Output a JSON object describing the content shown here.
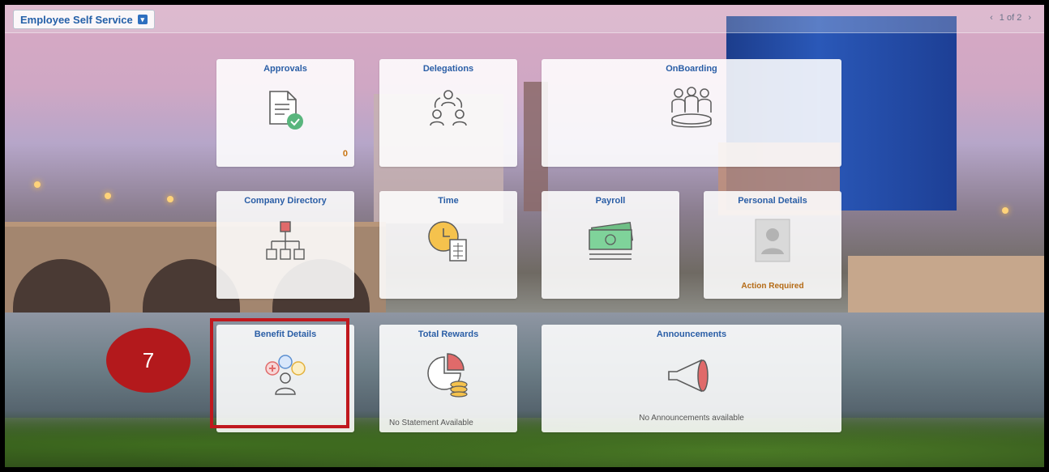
{
  "header": {
    "homepage_label": "Employee Self Service",
    "pager": "1 of 2"
  },
  "tiles": {
    "approvals": {
      "title": "Approvals",
      "count": "0"
    },
    "delegations": {
      "title": "Delegations"
    },
    "onboarding": {
      "title": "OnBoarding"
    },
    "company_directory": {
      "title": "Company Directory"
    },
    "time": {
      "title": "Time"
    },
    "payroll": {
      "title": "Payroll"
    },
    "personal_details": {
      "title": "Personal Details",
      "status": "Action Required"
    },
    "benefit_details": {
      "title": "Benefit Details"
    },
    "total_rewards": {
      "title": "Total Rewards",
      "footer": "No Statement Available"
    },
    "announcements": {
      "title": "Announcements",
      "footer": "No Announcements available"
    }
  },
  "annotation": {
    "step_number": "7"
  },
  "colors": {
    "tile_title": "#2a5ea6",
    "action": "#b46a14",
    "highlight": "#c0181e"
  },
  "icons": [
    "document-check-icon",
    "delegation-icon",
    "team-icon",
    "org-chart-icon",
    "clock-document-icon",
    "money-icon",
    "person-placeholder-icon",
    "benefits-people-icon",
    "pie-coins-icon",
    "megaphone-icon",
    "chevron-down-icon",
    "chevron-left-icon",
    "chevron-right-icon"
  ]
}
